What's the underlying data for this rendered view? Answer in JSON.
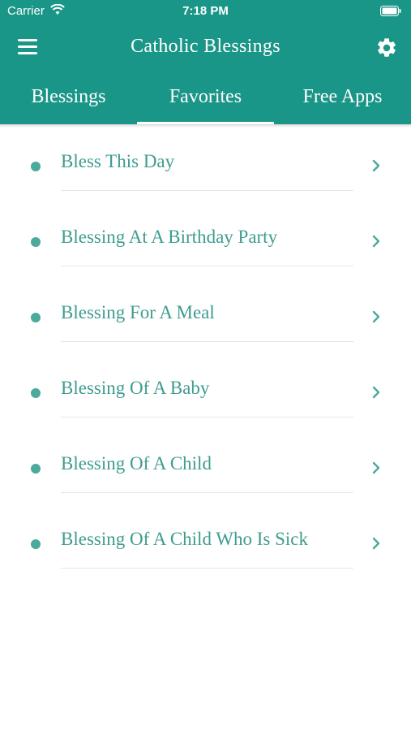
{
  "status_bar": {
    "carrier": "Carrier",
    "time": "7:18 PM"
  },
  "navbar": {
    "title": "Catholic Blessings",
    "menu_icon": "hamburger-menu-icon",
    "settings_icon": "gear-icon"
  },
  "tabs": [
    {
      "label": "Blessings",
      "active": false
    },
    {
      "label": "Favorites",
      "active": true
    },
    {
      "label": "Free Apps",
      "active": false
    }
  ],
  "favorites": [
    {
      "label": "Bless This Day"
    },
    {
      "label": "Blessing At A Birthday Party"
    },
    {
      "label": "Blessing For A Meal"
    },
    {
      "label": "Blessing Of A Baby"
    },
    {
      "label": "Blessing Of A Child"
    },
    {
      "label": "Blessing Of A Child Who Is Sick"
    }
  ],
  "colors": {
    "primary": "#1a9688",
    "item_text": "#3e9c8e",
    "bullet": "#4aaa9b",
    "chevron": "#4aaa9b"
  }
}
